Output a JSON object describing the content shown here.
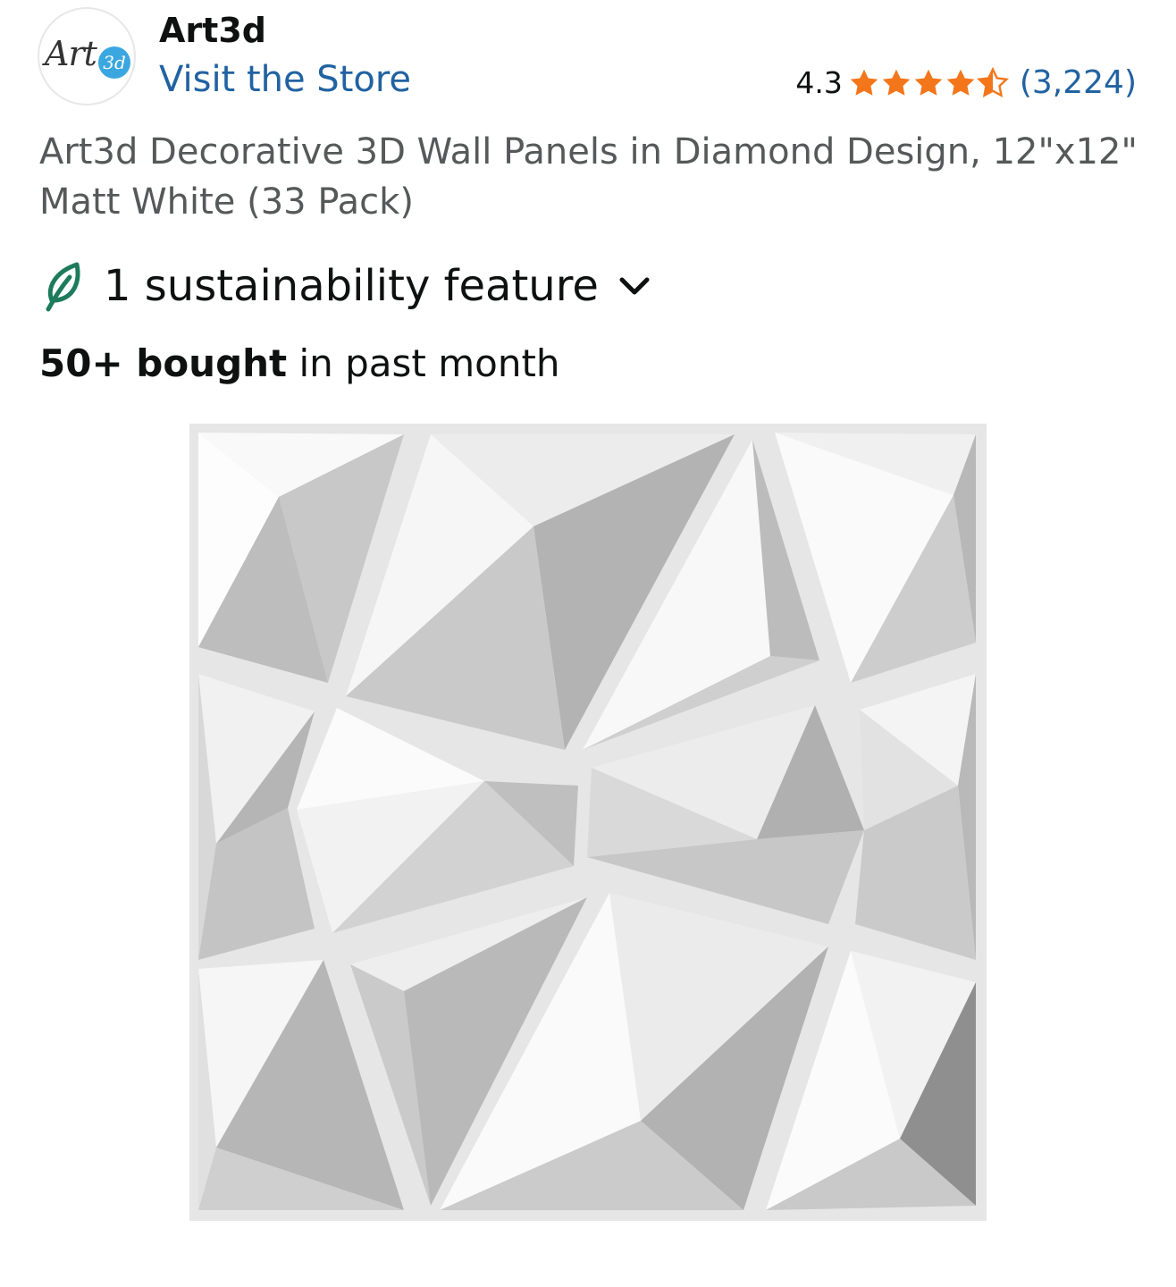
{
  "brand": {
    "logo_text": "Art",
    "logo_badge": "3d",
    "name": "Art3d",
    "store_link": "Visit the Store"
  },
  "rating": {
    "value": "4.3",
    "stars_out_of_5": 4.3,
    "count": "(3,224)",
    "star_color": "#f3761b"
  },
  "product": {
    "title": "Art3d Decorative 3D Wall Panels in Diamond Design, 12\"x12\" Matt White (33 Pack)"
  },
  "sustainability": {
    "label": "1 sustainability feature",
    "icon": "leaf-icon",
    "icon_color": "#1d7b5c",
    "expand_icon": "chevron-down-icon"
  },
  "purchases": {
    "bold": "50+ bought",
    "rest": " in past month"
  },
  "colors": {
    "link": "#2162a1",
    "text": "#0f1111",
    "secondary_text": "#565959"
  }
}
